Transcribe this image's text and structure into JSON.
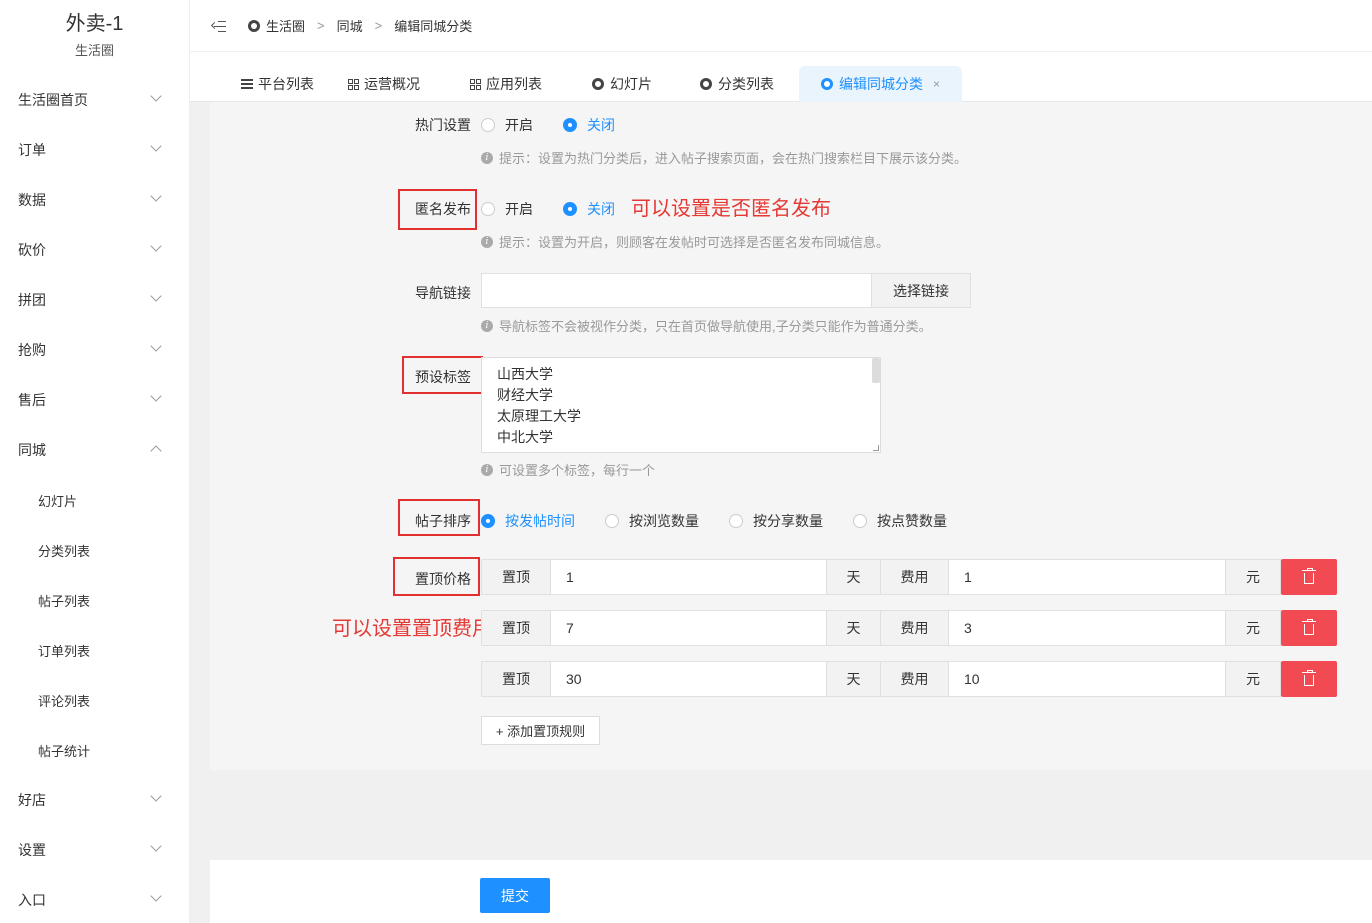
{
  "sidebar": {
    "title": "外卖-1",
    "subtitle": "生活圈",
    "menu": [
      "生活圈首页",
      "订单",
      "数据",
      "砍价",
      "拼团",
      "抢购",
      "售后",
      "同城"
    ],
    "sub_items": [
      "幻灯片",
      "分类列表",
      "帖子列表",
      "订单列表",
      "评论列表",
      "帖子统计"
    ],
    "menu_after": [
      "好店",
      "设置",
      "入口"
    ]
  },
  "breadcrumb": [
    "生活圈",
    "同城",
    "编辑同城分类"
  ],
  "breadcrumb_sep": ">",
  "tabs": [
    "平台列表",
    "运营概况",
    "应用列表",
    "幻灯片",
    "分类列表",
    "编辑同城分类"
  ],
  "tab_close": "×",
  "form": {
    "hot": {
      "label": "热门设置",
      "on": "开启",
      "off": "关闭",
      "hint": "提示：设置为热门分类后，进入帖子搜索页面，会在热门搜索栏目下展示该分类。"
    },
    "anon": {
      "label": "匿名发布",
      "on": "开启",
      "off": "关闭",
      "hint": "提示：设置为开启，则顾客在发帖时可选择是否匿名发布同城信息。"
    },
    "nav": {
      "label": "导航链接",
      "value": "",
      "button": "选择链接",
      "hint": "导航标签不会被视作分类，只在首页做导航使用,子分类只能作为普通分类。"
    },
    "tags": {
      "label": "预设标签",
      "items": [
        "山西大学",
        "财经大学",
        "太原理工大学",
        "中北大学"
      ],
      "hint": "可设置多个标签，每行一个"
    },
    "sort": {
      "label": "帖子排序",
      "options": [
        "按发帖时间",
        "按浏览数量",
        "按分享数量",
        "按点赞数量"
      ],
      "selected": 0
    },
    "price": {
      "label": "置顶价格",
      "top_label": "置顶",
      "day_label": "天",
      "fee_label": "费用",
      "yuan_label": "元",
      "rows": [
        {
          "days": "1",
          "fee": "1"
        },
        {
          "days": "7",
          "fee": "3"
        },
        {
          "days": "30",
          "fee": "10"
        }
      ]
    },
    "add_rule": "+ 添加置顶规则",
    "submit": "提交",
    "info_glyph": "i"
  },
  "annotations": {
    "anon": "可以设置是否匿名发布",
    "price": "可以设置置顶费用"
  }
}
